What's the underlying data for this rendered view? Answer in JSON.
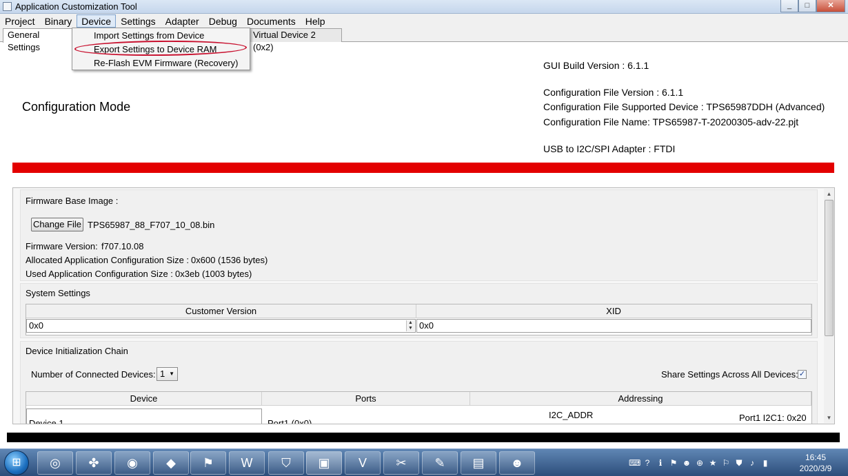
{
  "window": {
    "title": "Application Customization Tool",
    "buttons": [
      "_",
      "□",
      "✕"
    ]
  },
  "menubar": {
    "items": [
      "Project",
      "Binary",
      "Device",
      "Settings",
      "Adapter",
      "Debug",
      "Documents",
      "Help"
    ],
    "active": "Device"
  },
  "tabs": {
    "general": "General Settings",
    "virtual2": "Virtual Device 2 (0x2)"
  },
  "device_menu": {
    "items": [
      "Import Settings from Device",
      "Export Settings to Device RAM",
      "Re-Flash EVM Firmware (Recovery)"
    ],
    "highlight_color": "#c8102e"
  },
  "header": {
    "mode_title": "Configuration Mode",
    "gui_build": "GUI Build Version : 6.1.1",
    "config_version": "Configuration File Version : 6.1.1",
    "supported_device": "Configuration File Supported Device : TPS65987DDH (Advanced)",
    "config_name": "Configuration File Name: TPS65987-T-20200305-adv-22.pjt",
    "adapter": "USB to I2C/SPI Adapter : FTDI"
  },
  "firmware": {
    "group_label": "Firmware Base Image :",
    "change_button": "Change File",
    "file_name": "TPS65987_88_F707_10_08.bin",
    "version_label": "Firmware Version:",
    "version_value": "f707.10.08",
    "alloc_label": "Allocated Application Configuration Size :",
    "alloc_value": "0x600 (1536 bytes)",
    "used_label": "Used Application Configuration Size :",
    "used_value": "0x3eb (1003 bytes)"
  },
  "system_settings": {
    "label": "System Settings",
    "columns": [
      "Customer Version",
      "XID"
    ],
    "customer_version": "0x0",
    "xid": "0x0"
  },
  "init_chain": {
    "label": "Device Initialization Chain",
    "num_devices_label": "Number of Connected Devices:",
    "num_devices_value": "1",
    "share_label": "Share Settings Across All Devices:",
    "share_checked": true,
    "columns": [
      "Device",
      "Ports",
      "Addressing"
    ],
    "row": {
      "device": "Device 1",
      "ports": "Port1 (0x0)",
      "addressing_label": "I2C_ADDR",
      "addressing_value": "Port1 I2C1: 0x20"
    }
  },
  "taskbar": {
    "apps": [
      "chrome-icon",
      "clover-icon",
      "messenger-icon",
      "kite-icon",
      "acrobat-icon",
      "word-icon",
      "shield-app-icon",
      "tool-app-icon",
      "visio-icon",
      "snipping-icon",
      "paint-icon",
      "notepad-icon",
      "wechat-icon"
    ],
    "time": "16:45",
    "date": "2020/3/9"
  }
}
